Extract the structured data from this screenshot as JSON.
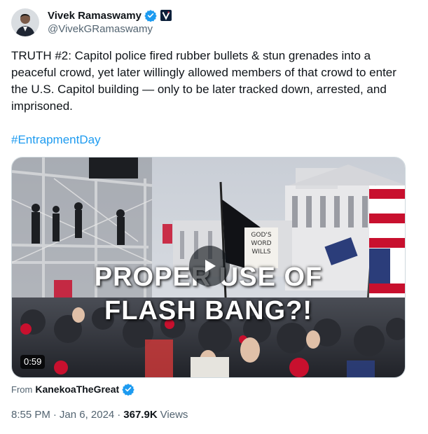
{
  "author": {
    "name": "Vivek Ramaswamy",
    "handle": "@VivekGRamaswamy",
    "verified_color": "#1d9bf0"
  },
  "tweet": {
    "text": "TRUTH #2: Capitol police fired rubber bullets & stun grenades into a peaceful crowd, yet later willingly allowed members of that crowd to enter the U.S. Capitol building — only to be later tracked down, arrested, and imprisoned.",
    "hashtag": "#EntrapmentDay"
  },
  "media": {
    "overlay_line1": "PROPER USE OF",
    "overlay_line2": "FLASH BANG?!",
    "sign_text": "GOD'S WORD WILLS",
    "duration": "0:59"
  },
  "source": {
    "prefix": "From",
    "name": "KanekoaTheGreat"
  },
  "meta": {
    "time": "8:55 PM",
    "separator": "·",
    "date": "Jan 6, 2024",
    "views_count": "367.9K",
    "views_label": "Views"
  },
  "colors": {
    "link": "#1d9bf0",
    "secondary_text": "#536471",
    "primary_text": "#0f1419"
  }
}
